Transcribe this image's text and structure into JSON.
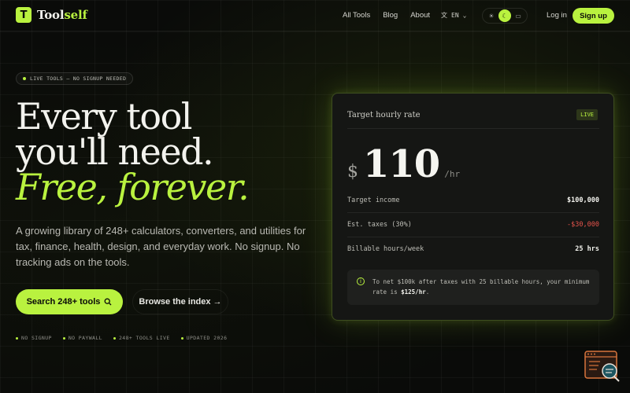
{
  "nav": {
    "logo_letter": "T",
    "logo_text_1": "Tool",
    "logo_text_2": "self",
    "links": [
      "All Tools",
      "Blog",
      "About"
    ],
    "lang": "EN",
    "login": "Log in",
    "signup": "Sign up"
  },
  "hero": {
    "badge": "LIVE TOOLS — NO SIGNUP NEEDED",
    "line1": "Every tool",
    "line2": "you'll need.",
    "line3": "Free, forever.",
    "lead": "A growing library of 248+ calculators, converters, and utilities for tax, finance, health, design, and everyday work. No signup. No tracking ads on the tools.",
    "primary_cta": "Search 248+ tools",
    "secondary_cta": "Browse the index →",
    "features": [
      "NO SIGNUP",
      "NO PAYWALL",
      "248+ TOOLS LIVE",
      "UPDATED 2026"
    ]
  },
  "card": {
    "title": "Target hourly rate",
    "live": "LIVE",
    "currency": "$",
    "rate": "110",
    "unit": "/hr",
    "rows": [
      {
        "label": "Target income",
        "value": "$100,000"
      },
      {
        "label": "Est. taxes (30%)",
        "value": "-$30,000"
      },
      {
        "label": "Billable hours/week",
        "value": "25 hrs"
      }
    ],
    "note_prefix": "To net $100k after taxes with 25 billable hours, your minimum rate is ",
    "note_value": "$125/hr",
    "note_suffix": "."
  },
  "colors": {
    "accent": "#b9f23f",
    "negative": "#e5534b",
    "background": "#0a0b09"
  }
}
